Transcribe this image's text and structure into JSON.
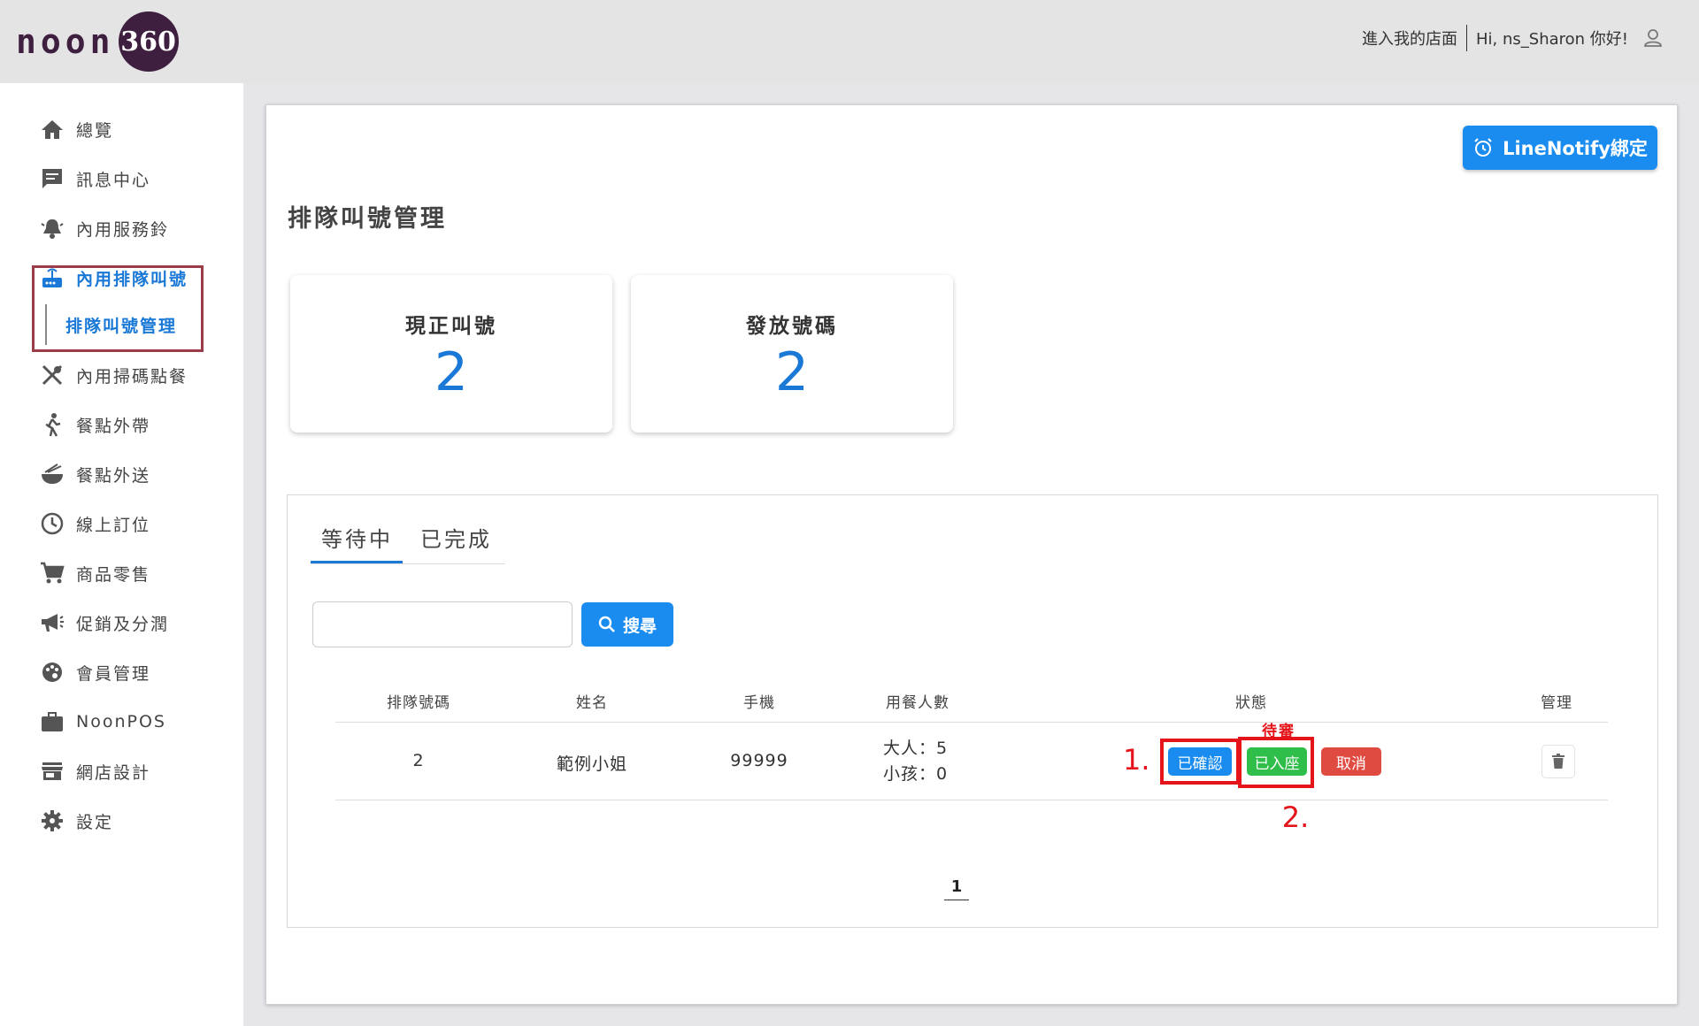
{
  "header": {
    "logo_text": "noon",
    "logo_badge": "360",
    "store_link": "進入我的店面",
    "greeting": "Hi, ns_Sharon 你好!"
  },
  "sidebar": {
    "items": [
      {
        "label": "總覽",
        "icon": "home-icon"
      },
      {
        "label": "訊息中心",
        "icon": "message-icon"
      },
      {
        "label": "內用服務鈴",
        "icon": "bell-icon"
      },
      {
        "label": "內用排隊叫號",
        "icon": "queue-icon"
      },
      {
        "label": "內用掃碼點餐",
        "icon": "utensils-icon"
      },
      {
        "label": "餐點外帶",
        "icon": "walking-icon"
      },
      {
        "label": "餐點外送",
        "icon": "noodle-bowl-icon"
      },
      {
        "label": "線上訂位",
        "icon": "clock-icon"
      },
      {
        "label": "商品零售",
        "icon": "cart-icon"
      },
      {
        "label": "促銷及分潤",
        "icon": "megaphone-icon"
      },
      {
        "label": "會員管理",
        "icon": "palette-icon"
      },
      {
        "label": "NoonPOS",
        "icon": "briefcase-icon"
      },
      {
        "label": "網店設計",
        "icon": "store-icon"
      },
      {
        "label": "設定",
        "icon": "gear-icon"
      }
    ],
    "sub_item": "排隊叫號管理"
  },
  "main": {
    "line_notify_label": "LineNotify綁定",
    "title": "排隊叫號管理",
    "stats": [
      {
        "label": "現正叫號",
        "value": "2"
      },
      {
        "label": "發放號碼",
        "value": "2"
      }
    ],
    "tabs": [
      {
        "label": "等待中"
      },
      {
        "label": "已完成"
      }
    ],
    "search": {
      "value": "",
      "placeholder": "",
      "button_label": "搜尋"
    },
    "table": {
      "columns": [
        "排隊號碼",
        "姓名",
        "手機",
        "用餐人數",
        "狀態",
        "管理"
      ],
      "rows": [
        {
          "number": "2",
          "name": "範例小姐",
          "phone": "99999",
          "adults": "大人：5",
          "children": "小孩：0",
          "status_text": "待審",
          "actions": {
            "confirm": "已確認",
            "seated": "已入座",
            "cancel": "取消"
          }
        }
      ]
    },
    "annotations": {
      "step1": "1.",
      "step2": "2."
    },
    "pagination": {
      "current": "1"
    }
  },
  "colors": {
    "brand": "#3e1f3f",
    "primary": "#1a8cf0",
    "success": "#2fbe4a",
    "danger": "#e04b41",
    "annotation": "#e4141a"
  }
}
